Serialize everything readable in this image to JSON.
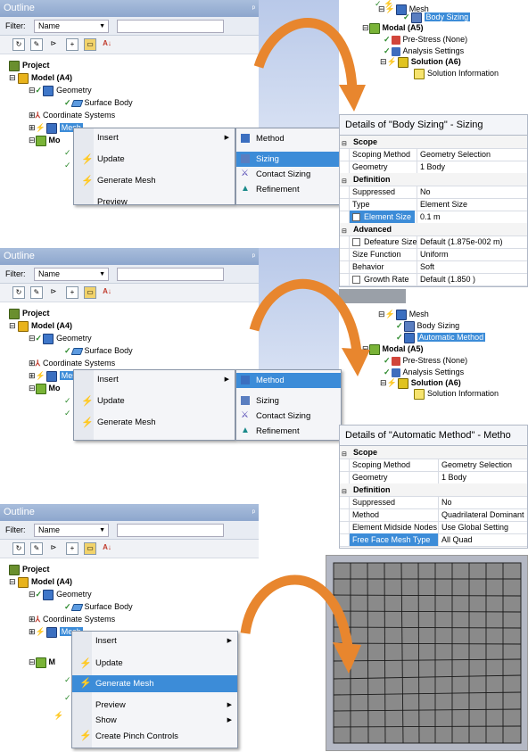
{
  "outline": {
    "title": "Outline",
    "pin": "ᵖ",
    "filter_label": "Filter:",
    "filter_value": "Name",
    "tree": {
      "project": "Project",
      "model": "Model (A4)",
      "geometry": "Geometry",
      "surface_body": "Surface Body",
      "coordinate_systems": "Coordinate Systems",
      "mesh": "Mesh",
      "modal_trunc": "Mo",
      "modal_trunc_bottom": "M"
    }
  },
  "panel1": {
    "menu": {
      "insert": "Insert",
      "update": "Update",
      "generate_mesh": "Generate Mesh",
      "preview": "Preview"
    },
    "submenu": [
      "Method",
      "Sizing",
      "Contact Sizing",
      "Refinement"
    ],
    "highlighted_submenu": "Sizing"
  },
  "panel2": {
    "menu": {
      "insert": "Insert",
      "update": "Update",
      "generate_mesh": "Generate Mesh"
    },
    "submenu": [
      "Method",
      "Sizing",
      "Contact Sizing",
      "Refinement"
    ],
    "highlighted_submenu": "Method"
  },
  "panel3": {
    "menu": {
      "insert": "Insert",
      "update": "Update",
      "generate_mesh": "Generate Mesh",
      "preview": "Preview",
      "show": "Show",
      "create_pinch": "Create Pinch Controls"
    },
    "highlighted": "Generate Mesh"
  },
  "right_tree1": {
    "mesh": "Mesh",
    "body_sizing": "Body Sizing",
    "modal": "Modal (A5)",
    "pre_stress": "Pre-Stress (None)",
    "analysis_settings": "Analysis Settings",
    "solution": "Solution (A6)",
    "solution_info": "Solution Information"
  },
  "details1": {
    "title": "Details of \"Body Sizing\" - Sizing",
    "sections": {
      "scope": "Scope",
      "definition": "Definition",
      "advanced": "Advanced"
    },
    "rows": {
      "scoping_method": [
        "Scoping Method",
        "Geometry Selection"
      ],
      "geometry": [
        "Geometry",
        "1 Body"
      ],
      "suppressed": [
        "Suppressed",
        "No"
      ],
      "type": [
        "Type",
        "Element Size"
      ],
      "element_size": [
        "Element Size",
        "0.1 m"
      ],
      "defeature_size": [
        "Defeature Size",
        "Default (1.875e-002 m)"
      ],
      "size_function": [
        "Size Function",
        "Uniform"
      ],
      "behavior": [
        "Behavior",
        "Soft"
      ],
      "growth_rate": [
        "Growth Rate",
        "Default (1.850 )"
      ]
    }
  },
  "right_tree2": {
    "mesh": "Mesh",
    "body_sizing": "Body Sizing",
    "automatic_method": "Automatic Method",
    "modal": "Modal (A5)",
    "pre_stress": "Pre-Stress (None)",
    "analysis_settings": "Analysis Settings",
    "solution": "Solution (A6)",
    "solution_info": "Solution Information"
  },
  "details2": {
    "title": "Details of \"Automatic Method\" - Metho",
    "sections": {
      "scope": "Scope",
      "definition": "Definition"
    },
    "rows": {
      "scoping_method": [
        "Scoping Method",
        "Geometry Selection"
      ],
      "geometry": [
        "Geometry",
        "1 Body"
      ],
      "suppressed": [
        "Suppressed",
        "No"
      ],
      "method": [
        "Method",
        "Quadrilateral Dominant"
      ],
      "midside": [
        "Element Midside Nodes",
        "Use Global Setting"
      ],
      "free_face": [
        "Free Face Mesh Type",
        "All Quad"
      ]
    }
  },
  "colors": {
    "highlight": "#3c8cd8",
    "arrow": "#e8862e",
    "mesh_fill": "#8a8a8a"
  }
}
